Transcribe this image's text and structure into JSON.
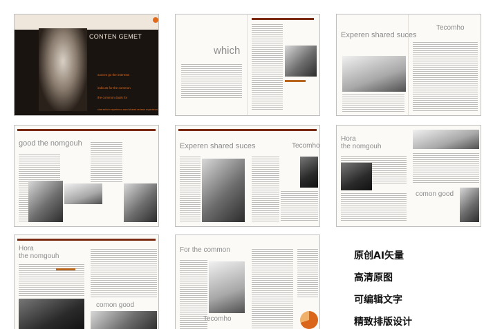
{
  "spreads": {
    "cover": {
      "title": "CONTEN GEMET",
      "lines": [
        "succes go the interests",
        "indicuts for the common",
        "the common duals for",
        "shat eshich experienco aand shared reviews experience"
      ]
    },
    "which": {
      "title": "which"
    },
    "experen_top": {
      "title": "Experen shared suces",
      "brand": "Tecomho"
    },
    "good": {
      "title": "good the nomgouh"
    },
    "experen_mid": {
      "title": "Experen shared suces",
      "brand": "Tecomho"
    },
    "hora_right": {
      "title_line1": "Hora",
      "title_line2": "the nomgouh",
      "subtitle": "comon good"
    },
    "hora_bottom": {
      "title_line1": "Hora",
      "title_line2": "the nomgouh",
      "subtitle": "comon good"
    },
    "common": {
      "title": "For the common",
      "brand": "Tecomho"
    }
  },
  "labels": [
    "原创AI矢量",
    "高清原图",
    "可编辑文字",
    "精致排版设计"
  ]
}
